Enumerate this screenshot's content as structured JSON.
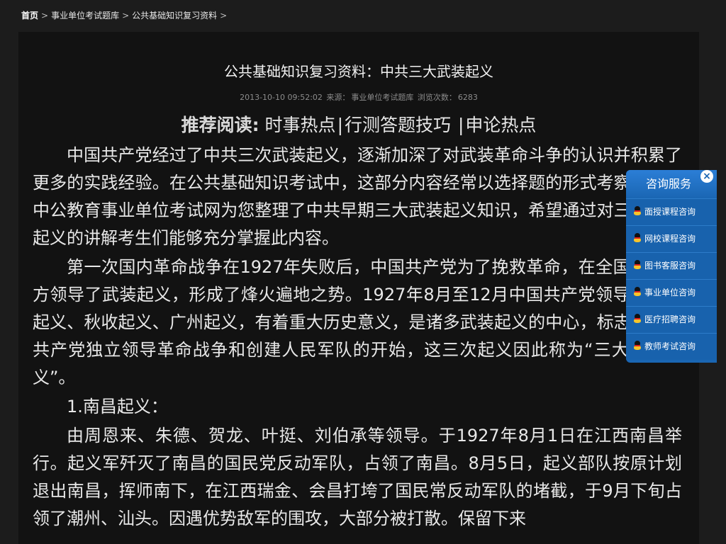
{
  "breadcrumb": {
    "home": "首页",
    "sep": ">",
    "items": [
      "事业单位考试题库",
      "公共基础知识复习资料"
    ]
  },
  "article": {
    "title": "公共基础知识复习资料：中共三大武装起义",
    "meta": {
      "datetime": "2013-10-10 09:52:02",
      "source_label": "来源：",
      "source": "事业单位考试题库",
      "views_label": "浏览次数：",
      "views": "6283"
    },
    "recommend": {
      "label": "推荐阅读:",
      "links": [
        "时事热点",
        "行测答题技巧 ",
        "申论热点"
      ],
      "divider": "|"
    },
    "paragraphs": [
      "中国共产党经过了中共三次武装起义，逐渐加深了对武装革命斗争的认识并积累了更多的实践经验。在公共基础知识考试中，这部分内容经常以选择题的形式考察，今天中公教育事业单位考试网为您整理了中共早期三大武装起义知识，希望通过对三大武装起义的讲解考生们能够充分掌握此内容。",
      "第一次国内革命战争在1927年失败后，中国共产党为了挽救革命，在全国许多地方领导了武装起义，形成了烽火遍地之势。1927年8月至12月中国共产党领导的南昌起义、秋收起义、广州起义，有着重大历史意义，是诸多武装起义的中心，标志着中国共产党独立领导革命战争和创建人民军队的开始，这三次起义因此称为“三大武装起义”。",
      "1.南昌起义：",
      "由周恩来、朱德、贺龙、叶挺、刘伯承等领导。于1927年8月1日在江西南昌举行。起义军歼灭了南昌的国民党反动军队，占领了南昌。8月5日，起义部队按原计划退出南昌，挥师南下，在江西瑞金、会昌打垮了国民常反动军队的堵截，于9月下旬占领了潮州、汕头。因遇优势敌军的围攻，大部分被打散。保留下来"
    ]
  },
  "consult": {
    "title": "咨询服务",
    "close": "×",
    "items": [
      "面授课程咨询",
      "网校课程咨询",
      "图书客服咨询",
      "事业单位咨询",
      "医疗招聘咨询",
      "教师考试咨询"
    ]
  },
  "colors": {
    "page_bg": "#1c1c1c",
    "article_bg": "#121212",
    "panel_blue": "#1a66b3"
  }
}
